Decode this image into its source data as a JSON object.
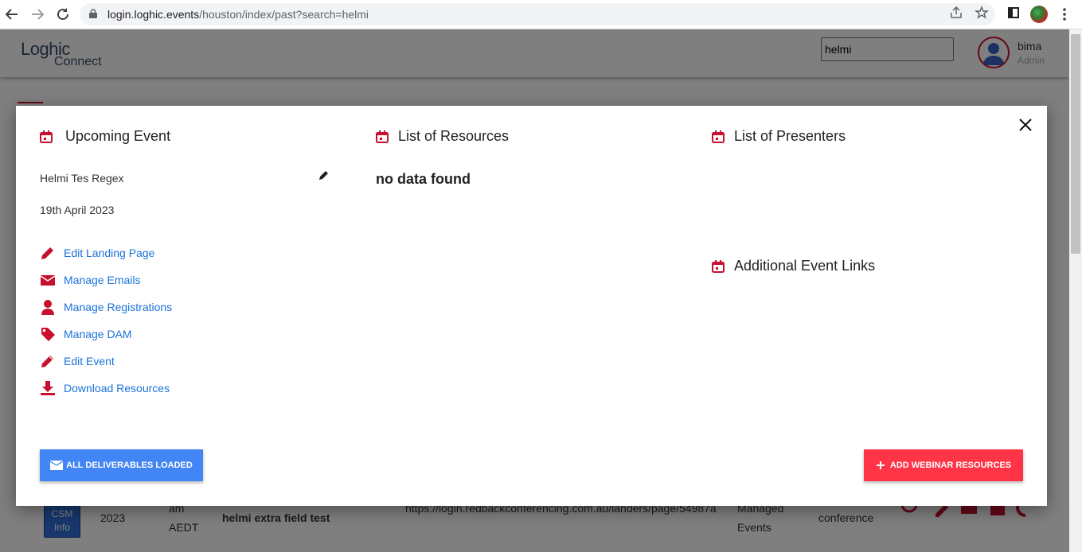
{
  "browser": {
    "url_host": "login.loghic.events",
    "url_path": "/houston/index/past?search=helmi"
  },
  "header": {
    "logo_line1": "Loghic",
    "logo_line2": "Connect",
    "search_value": "helmi",
    "user_name": "bima",
    "user_role": "Admin"
  },
  "background_row": {
    "csm_label_1": "CSM",
    "csm_label_2": "Info",
    "year": "2023",
    "time_1": "am",
    "time_2": "AEDT",
    "event_name": "helmi extra field test",
    "url": "https://login.redbackconferencing.com.au/landers/page/54987a",
    "type_1": "Managed",
    "type_2": "Events",
    "category": "conference"
  },
  "modal": {
    "upcoming_title": "Upcoming Event",
    "resources_title": "List of Resources",
    "presenters_title": "List of Presenters",
    "links_title": "Additional Event Links",
    "event_name": "Helmi Tes Regex",
    "event_date": "19th April 2023",
    "no_data": "no data found",
    "actions": [
      {
        "label": "Edit Landing Page",
        "icon": "pencil-icon"
      },
      {
        "label": "Manage Emails",
        "icon": "envelope-icon"
      },
      {
        "label": "Manage Registrations",
        "icon": "user-icon"
      },
      {
        "label": "Manage DAM",
        "icon": "tag-icon"
      },
      {
        "label": "Edit Event",
        "icon": "pencil-icon"
      },
      {
        "label": "Download Resources",
        "icon": "download-icon"
      }
    ],
    "deliverables_button": "ALL DELIVERABLES LOADED",
    "add_resources_button": "ADD WEBINAR RESOURCES"
  },
  "colors": {
    "accent_red": "#c8102e",
    "link_blue": "#1a73d9",
    "primary_blue": "#4285f4",
    "danger_red": "#ff3547"
  }
}
